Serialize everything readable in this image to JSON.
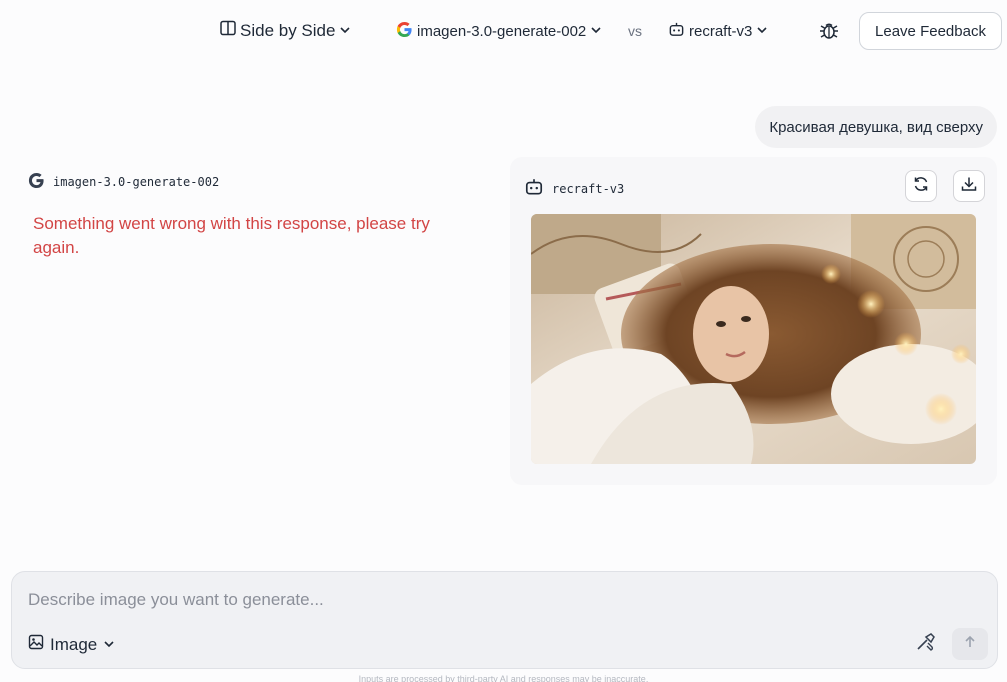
{
  "header": {
    "mode_label": "Side by Side",
    "model_a": "imagen-3.0-generate-002",
    "vs_label": "vs",
    "model_b": "recraft-v3",
    "feedback_label": "Leave Feedback"
  },
  "conversation": {
    "user_prompt": "Красивая девушка, вид сверху",
    "left_response": {
      "model": "imagen-3.0-generate-002",
      "error": "Something went wrong with this response, please try again."
    },
    "right_response": {
      "model": "recraft-v3"
    }
  },
  "composer": {
    "placeholder": "Describe image you want to generate...",
    "mode_label": "Image"
  },
  "footer": {
    "disclaimer": "Inputs are processed by third-party AI and responses may be inaccurate."
  },
  "icons": {
    "mode": "side-by-side-icon",
    "model_a": "google-icon",
    "model_b": "robot-icon",
    "bug": "bug-icon",
    "refresh": "refresh-icon",
    "download": "download-icon",
    "image_mode": "image-icon",
    "tool": "wand-icon",
    "send": "arrow-up-icon"
  }
}
